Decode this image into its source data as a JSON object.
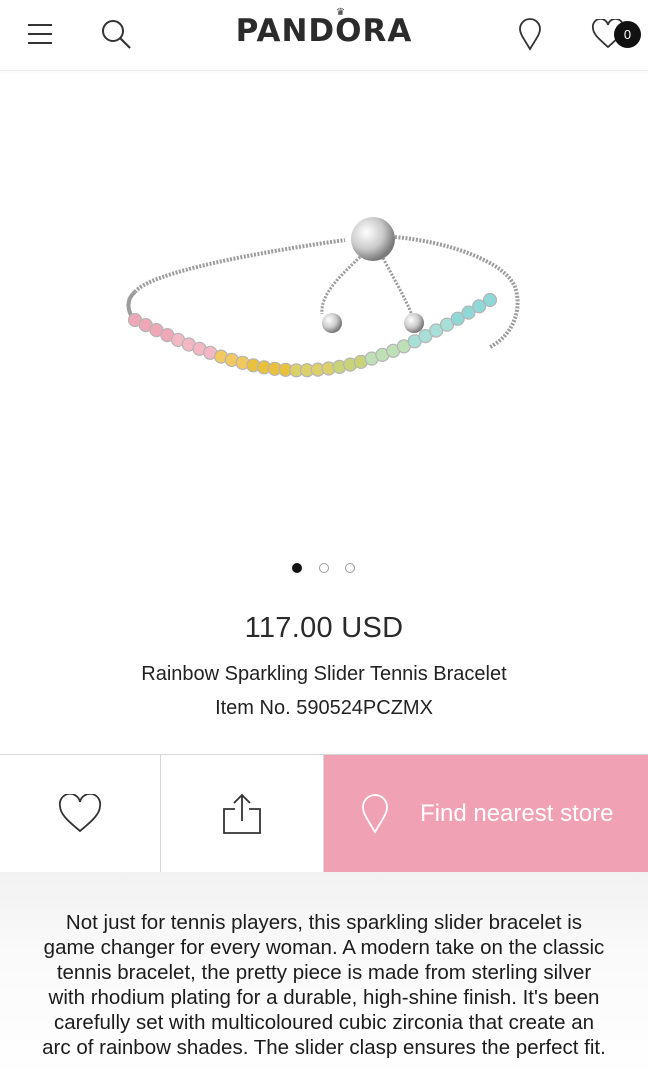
{
  "header": {
    "brand": "PANDORA",
    "crown": "♛",
    "wishlist_count": "0",
    "icons": [
      "menu-icon",
      "search-icon",
      "location-pin-icon",
      "heart-icon"
    ]
  },
  "product": {
    "price": "117.00 USD",
    "name": "Rainbow Sparkling Slider Tennis Bracelet",
    "item_number": "Item No. 590524PCZMX",
    "image_dots": {
      "count": 3,
      "active_index": 0
    },
    "description": "Not just for tennis players, this sparkling slider bracelet is game changer for every woman. A modern take on the classic tennis bracelet, the pretty piece is made from sterling silver with rhodium plating for a durable, high-shine finish. It's been carefully set with multicoloured cubic zirconia that create an arc of rainbow shades. The slider clasp ensures the perfect fit."
  },
  "actions": {
    "store_label": "Find nearest store",
    "icons": [
      "heart-icon",
      "share-icon",
      "location-pin-icon"
    ]
  },
  "colors": {
    "accent_pink": "#f0a2b4",
    "text": "#222222",
    "stone_colors": [
      "#f0a7b8",
      "#f4b7c4",
      "#f3c860",
      "#e9c13c",
      "#dcd06a",
      "#c9d47a",
      "#bfe0b6",
      "#a6e0d8",
      "#8fd8d6"
    ]
  }
}
